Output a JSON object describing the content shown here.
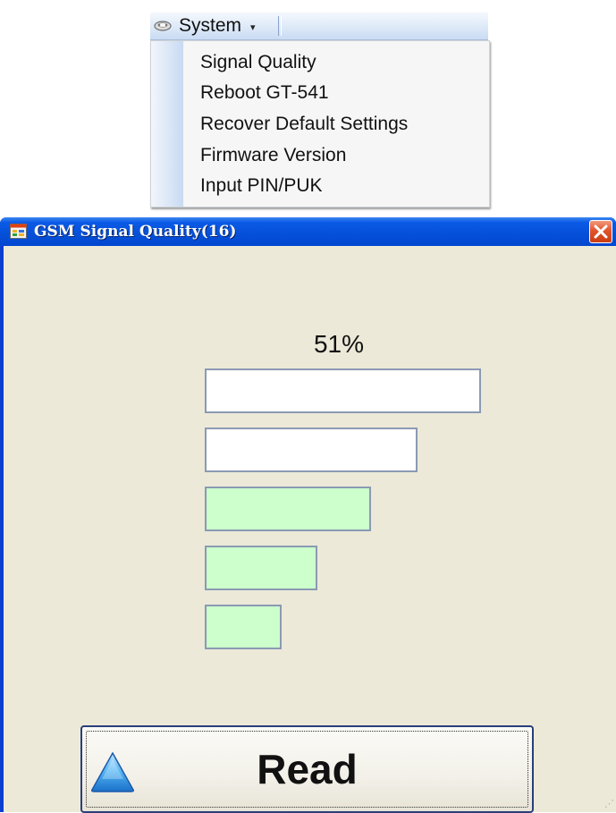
{
  "menu": {
    "root_label": "System",
    "root_icon": "system-icon",
    "items": [
      {
        "label": "Signal Quality"
      },
      {
        "label": "Reboot GT-541"
      },
      {
        "label": "Recover Default Settings"
      },
      {
        "label": "Firmware Version"
      },
      {
        "label": "Input PIN/PUK"
      }
    ]
  },
  "window": {
    "title": "GSM Signal Quality(16)",
    "icon": "app-icon",
    "close_icon": "close-icon"
  },
  "signal": {
    "percent_text": "51%",
    "bars_total": 5,
    "bars_active": 3,
    "active_color": "#ccffcc",
    "inactive_color": "#ffffff"
  },
  "read_button": {
    "label": "Read",
    "icon": "triangle-up-icon"
  }
}
